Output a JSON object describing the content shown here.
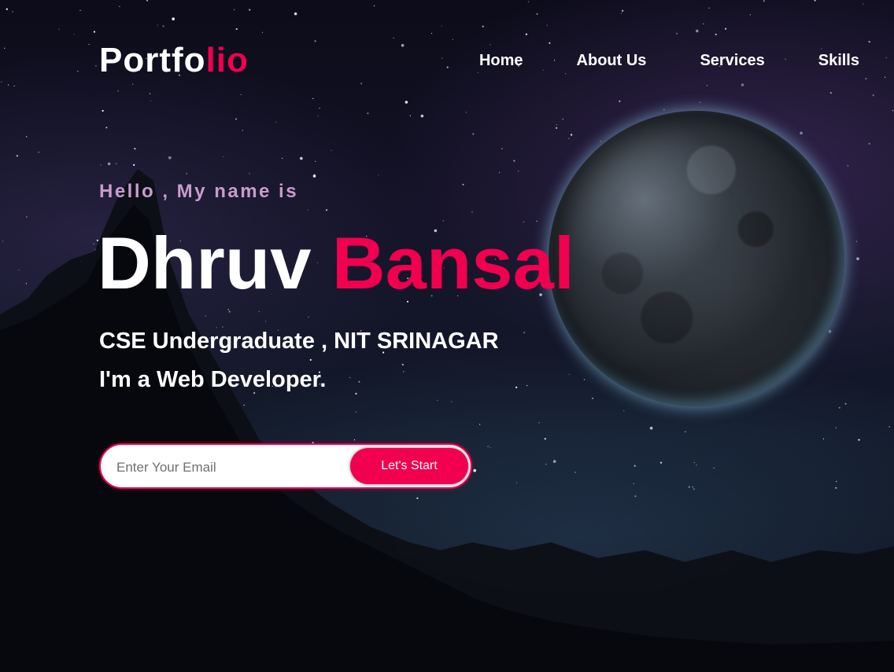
{
  "theme": {
    "accent": "#f0004e",
    "greeting_color": "#c79ccc",
    "text": "#ffffff"
  },
  "header": {
    "logo_main": "Portfo",
    "logo_accent": "lio",
    "nav": [
      {
        "label": "Home"
      },
      {
        "label": "About Us"
      },
      {
        "label": "Services"
      },
      {
        "label": "Skills"
      }
    ]
  },
  "hero": {
    "greeting": "Hello , My name is",
    "first_name": "Dhruv",
    "last_name": "Bansal",
    "subtitle": "CSE Undergraduate , NIT SRINAGAR",
    "role": "I'm a Web Developer.",
    "email": {
      "placeholder": "Enter Your Email",
      "value": ""
    },
    "cta_label": "Let's Start"
  },
  "background": {
    "icons": [
      "planet-image",
      "mountain-silhouette",
      "starfield"
    ]
  }
}
